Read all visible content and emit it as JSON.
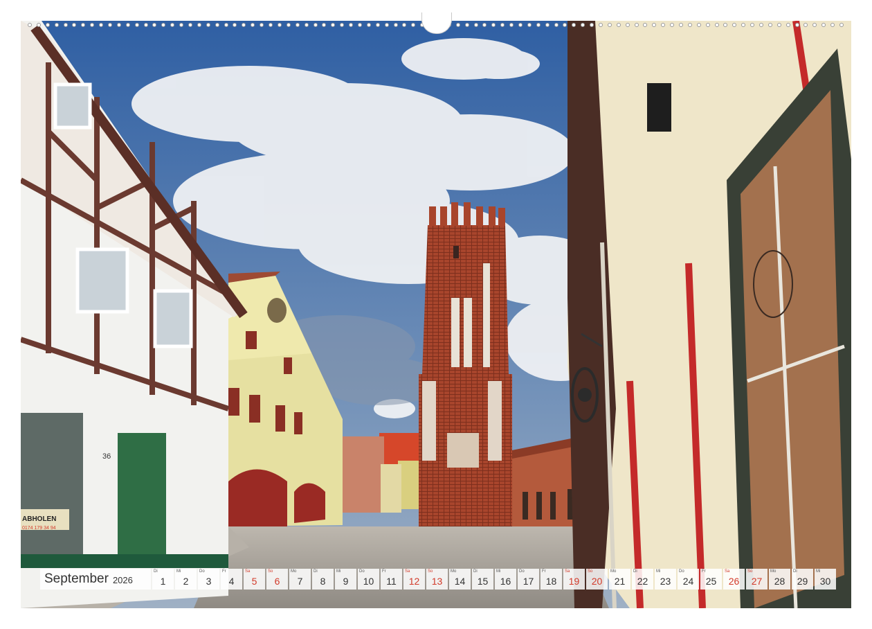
{
  "calendar": {
    "month": "September",
    "year": "2026",
    "days": [
      {
        "wd": "Di",
        "d": "1",
        "weekend": false
      },
      {
        "wd": "Mi",
        "d": "2",
        "weekend": false
      },
      {
        "wd": "Do",
        "d": "3",
        "weekend": false
      },
      {
        "wd": "Fr",
        "d": "4",
        "weekend": false
      },
      {
        "wd": "Sa",
        "d": "5",
        "weekend": true
      },
      {
        "wd": "So",
        "d": "6",
        "weekend": true
      },
      {
        "wd": "Mo",
        "d": "7",
        "weekend": false
      },
      {
        "wd": "Di",
        "d": "8",
        "weekend": false
      },
      {
        "wd": "Mi",
        "d": "9",
        "weekend": false
      },
      {
        "wd": "Do",
        "d": "10",
        "weekend": false
      },
      {
        "wd": "Fr",
        "d": "11",
        "weekend": false
      },
      {
        "wd": "Sa",
        "d": "12",
        "weekend": true
      },
      {
        "wd": "So",
        "d": "13",
        "weekend": true
      },
      {
        "wd": "Mo",
        "d": "14",
        "weekend": false
      },
      {
        "wd": "Di",
        "d": "15",
        "weekend": false
      },
      {
        "wd": "Mi",
        "d": "16",
        "weekend": false
      },
      {
        "wd": "Do",
        "d": "17",
        "weekend": false
      },
      {
        "wd": "Fr",
        "d": "18",
        "weekend": false
      },
      {
        "wd": "Sa",
        "d": "19",
        "weekend": true
      },
      {
        "wd": "So",
        "d": "20",
        "weekend": true
      },
      {
        "wd": "Mo",
        "d": "21",
        "weekend": false
      },
      {
        "wd": "Di",
        "d": "22",
        "weekend": false
      },
      {
        "wd": "Mi",
        "d": "23",
        "weekend": false
      },
      {
        "wd": "Do",
        "d": "24",
        "weekend": false
      },
      {
        "wd": "Fr",
        "d": "25",
        "weekend": false
      },
      {
        "wd": "Sa",
        "d": "26",
        "weekend": true
      },
      {
        "wd": "So",
        "d": "27",
        "weekend": true
      },
      {
        "wd": "Mo",
        "d": "28",
        "weekend": false
      },
      {
        "wd": "Di",
        "d": "29",
        "weekend": false
      },
      {
        "wd": "Mi",
        "d": "30",
        "weekend": false
      }
    ]
  },
  "photo": {
    "house_number": "36",
    "sign_abholen": "ABHOLEN",
    "sign_phone": "0174 179 34 94"
  },
  "colors": {
    "weekend": "#d23a2a",
    "weekday": "#333333",
    "strip_bg": "#ffffff"
  }
}
